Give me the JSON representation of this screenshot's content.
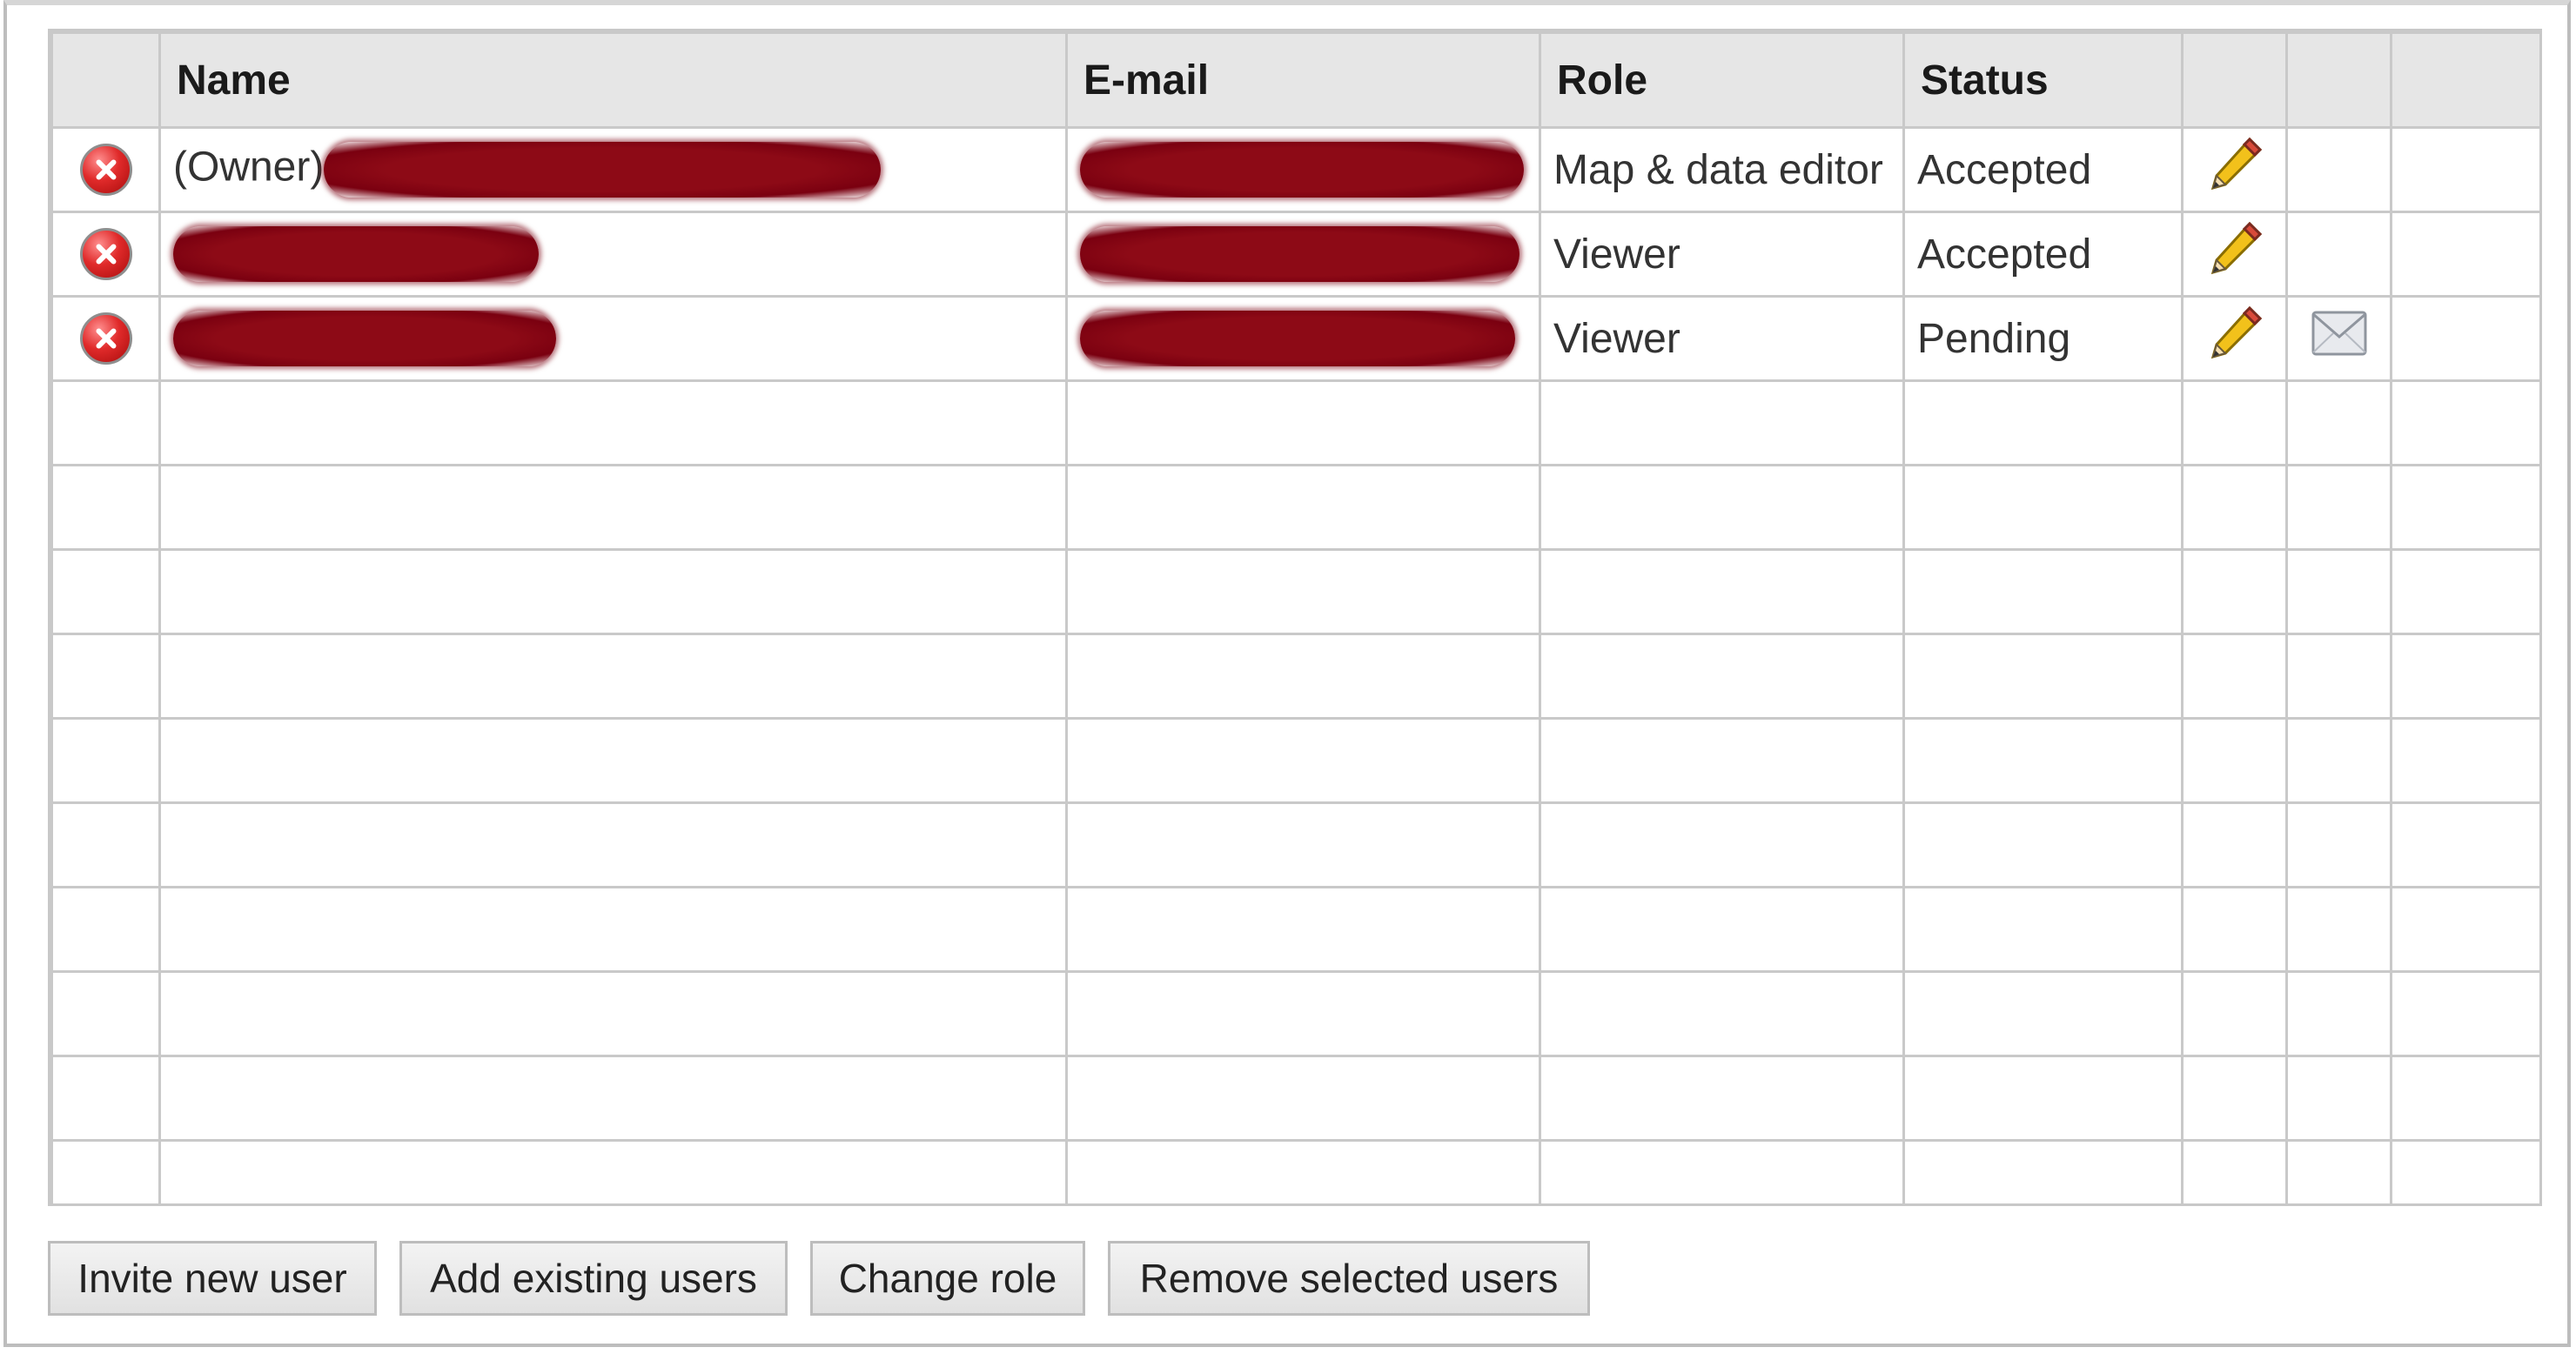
{
  "table": {
    "headers": [
      "",
      "Name",
      "E-mail",
      "Role",
      "Status",
      "",
      "",
      ""
    ],
    "rows": [
      {
        "name_prefix": "(Owner)",
        "role": "Map & data editor",
        "status": "Accepted",
        "has_mail": false
      },
      {
        "name_prefix": "",
        "role": "Viewer",
        "status": "Accepted",
        "has_mail": false
      },
      {
        "name_prefix": "",
        "role": "Viewer",
        "status": "Pending",
        "has_mail": true
      }
    ],
    "empty_rows": 10
  },
  "buttons": {
    "invite": "Invite new user",
    "add_existing": "Add existing users",
    "change_role": "Change role",
    "remove_selected": "Remove selected users"
  },
  "icons": {
    "remove": "remove-user-icon",
    "edit": "pencil-icon",
    "resend": "envelope-icon"
  },
  "colors": {
    "header_bg": "#e6e6e6",
    "grid_line": "#c9c9c9",
    "redaction": "#8d0a16",
    "delete_red": "#e02a2a"
  }
}
